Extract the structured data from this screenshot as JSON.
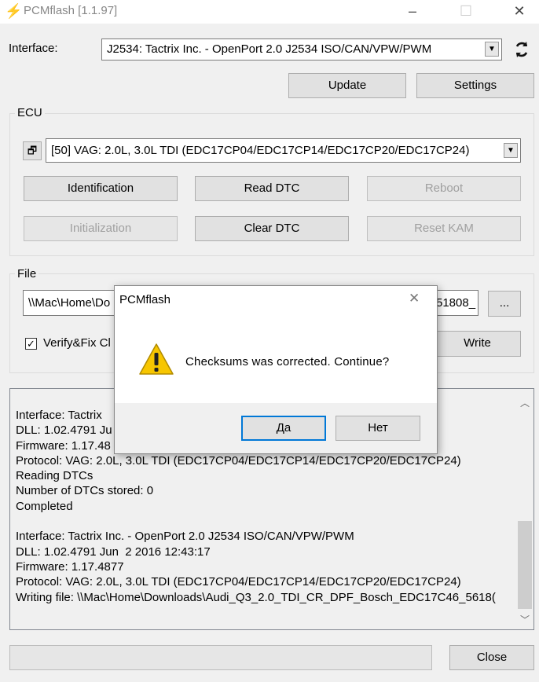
{
  "window": {
    "title": "PCMflash [1.1.97]",
    "controls": {
      "minimize": "–",
      "maximize": "☐",
      "close": "✕"
    }
  },
  "interface": {
    "label": "Interface:",
    "selected": "J2534: Tactrix Inc. - OpenPort 2.0 J2534 ISO/CAN/VPW/PWM",
    "refresh_icon": "refresh-icon",
    "update_label": "Update",
    "settings_label": "Settings"
  },
  "ecu": {
    "group_label": "ECU",
    "selected": "[50] VAG: 2.0L, 3.0L TDI (EDC17CP04/EDC17CP14/EDC17CP20/EDC17CP24)",
    "buttons": {
      "identification": "Identification",
      "read_dtc": "Read DTC",
      "reboot": "Reboot",
      "initialization": "Initialization",
      "clear_dtc": "Clear DTC",
      "reset_kam": "Reset KAM"
    }
  },
  "file": {
    "group_label": "File",
    "path_start": "\\\\Mac\\Home\\Do",
    "path_end": "51808_",
    "browse_label": "...",
    "verify_label": "Verify&Fix Cl",
    "verify_checked": true,
    "write_label": "Write"
  },
  "log": {
    "lines": [
      "Interface: Tactrix",
      "DLL: 1.02.4791 Ju",
      "Firmware: 1.17.48",
      "Protocol: VAG: 2.0L, 3.0L TDI (EDC17CP04/EDC17CP14/EDC17CP20/EDC17CP24)",
      "Reading DTCs",
      "Number of DTCs stored: 0",
      "Completed",
      "",
      "Interface: Tactrix Inc. - OpenPort 2.0 J2534 ISO/CAN/VPW/PWM",
      "DLL: 1.02.4791 Jun  2 2016 12:43:17",
      "Firmware: 1.17.4877",
      "Protocol: VAG: 2.0L, 3.0L TDI (EDC17CP04/EDC17CP14/EDC17CP20/EDC17CP24)",
      "Writing file: \\\\Mac\\Home\\Downloads\\Audi_Q3_2.0_TDI_CR_DPF_Bosch_EDC17C46_5618("
    ]
  },
  "footer": {
    "close_label": "Close"
  },
  "dialog": {
    "title": "PCMflash",
    "message": "Checksums was corrected. Continue?",
    "icon": "warning-icon",
    "yes_label": "Да",
    "no_label": "Нет",
    "close_glyph": "✕"
  },
  "colors": {
    "window_bg": "#f0f0f0",
    "accent": "#0078d7",
    "warning": "#f7c600"
  }
}
